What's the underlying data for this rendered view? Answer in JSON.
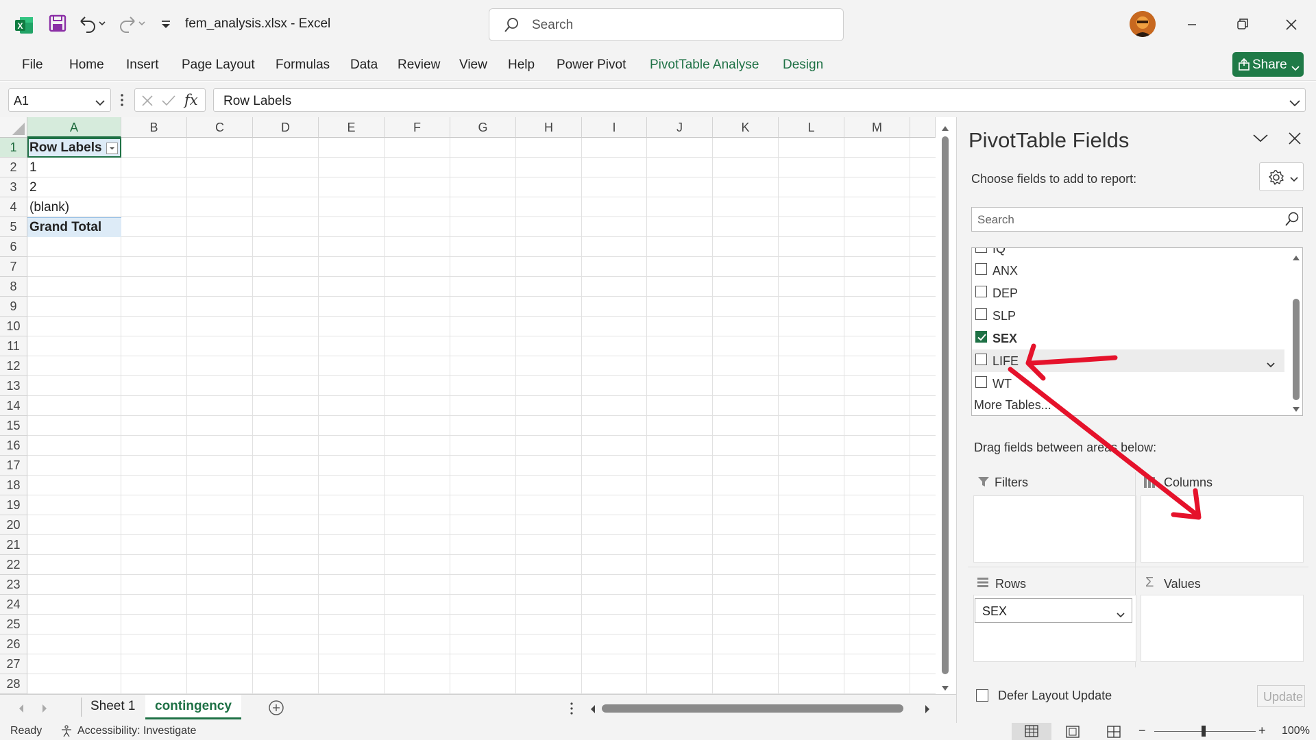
{
  "app": {
    "doc_title": "fem_analysis.xlsx  -  Excel",
    "search_placeholder": "Search"
  },
  "ribbon": {
    "tabs": [
      "File",
      "Home",
      "Insert",
      "Page Layout",
      "Formulas",
      "Data",
      "Review",
      "View",
      "Help",
      "Power Pivot",
      "PivotTable Analyse",
      "Design"
    ],
    "share_label": "Share"
  },
  "formula_bar": {
    "name_box": "A1",
    "fx": "fx",
    "formula": "Row Labels"
  },
  "grid": {
    "columns": [
      "A",
      "B",
      "C",
      "D",
      "E",
      "F",
      "G",
      "H",
      "I",
      "J",
      "K",
      "L",
      "M"
    ],
    "selected_column": "A",
    "rows": [
      "1",
      "2",
      "3",
      "4",
      "5",
      "6",
      "7",
      "8",
      "9",
      "10",
      "11",
      "12",
      "13",
      "14",
      "15",
      "16",
      "17",
      "18",
      "19",
      "20",
      "21",
      "22",
      "23",
      "24",
      "25",
      "26",
      "27",
      "28"
    ],
    "cells": {
      "A1": "Row Labels",
      "A2": "1",
      "A3": "2",
      "A4": "(blank)",
      "A5": "Grand Total"
    }
  },
  "sheets": {
    "tabs": [
      "Sheet 1",
      "contingency"
    ],
    "active": "contingency"
  },
  "status": {
    "ready": "Ready",
    "accessibility": "Accessibility: Investigate",
    "zoom": "100%"
  },
  "pivot_pane": {
    "title": "PivotTable Fields",
    "subtitle": "Choose fields to add to report:",
    "search_placeholder": "Search",
    "fields": [
      {
        "name": "IQ",
        "checked": false
      },
      {
        "name": "ANX",
        "checked": false
      },
      {
        "name": "DEP",
        "checked": false
      },
      {
        "name": "SLP",
        "checked": false
      },
      {
        "name": "SEX",
        "checked": true
      },
      {
        "name": "LIFE",
        "checked": false
      },
      {
        "name": "WT",
        "checked": false
      }
    ],
    "more_tables": "More Tables...",
    "drag_label": "Drag fields between areas below:",
    "areas": {
      "filters": "Filters",
      "columns": "Columns",
      "rows": "Rows",
      "values": "Values"
    },
    "rows_chip": "SEX",
    "defer_label": "Defer Layout Update",
    "update_label": "Update"
  },
  "colors": {
    "excel_green": "#1e7145",
    "arrow_red": "#e5122b",
    "pivot_header_fill": "#ddebf7"
  }
}
